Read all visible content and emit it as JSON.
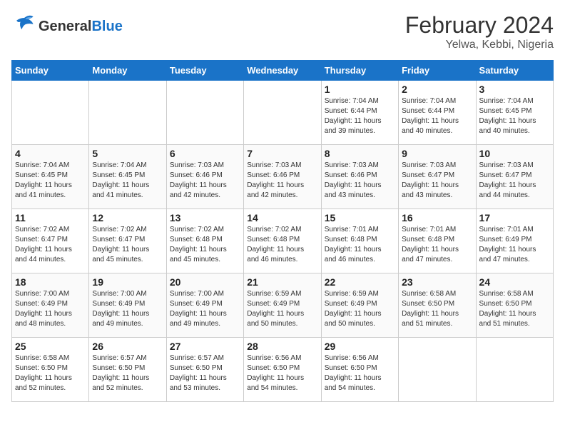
{
  "header": {
    "logo_general": "General",
    "logo_blue": "Blue",
    "title": "February 2024",
    "subtitle": "Yelwa, Kebbi, Nigeria"
  },
  "days_of_week": [
    "Sunday",
    "Monday",
    "Tuesday",
    "Wednesday",
    "Thursday",
    "Friday",
    "Saturday"
  ],
  "weeks": [
    [
      {
        "day": "",
        "info": ""
      },
      {
        "day": "",
        "info": ""
      },
      {
        "day": "",
        "info": ""
      },
      {
        "day": "",
        "info": ""
      },
      {
        "day": "1",
        "info": "Sunrise: 7:04 AM\nSunset: 6:44 PM\nDaylight: 11 hours\nand 39 minutes."
      },
      {
        "day": "2",
        "info": "Sunrise: 7:04 AM\nSunset: 6:44 PM\nDaylight: 11 hours\nand 40 minutes."
      },
      {
        "day": "3",
        "info": "Sunrise: 7:04 AM\nSunset: 6:45 PM\nDaylight: 11 hours\nand 40 minutes."
      }
    ],
    [
      {
        "day": "4",
        "info": "Sunrise: 7:04 AM\nSunset: 6:45 PM\nDaylight: 11 hours\nand 41 minutes."
      },
      {
        "day": "5",
        "info": "Sunrise: 7:04 AM\nSunset: 6:45 PM\nDaylight: 11 hours\nand 41 minutes."
      },
      {
        "day": "6",
        "info": "Sunrise: 7:03 AM\nSunset: 6:46 PM\nDaylight: 11 hours\nand 42 minutes."
      },
      {
        "day": "7",
        "info": "Sunrise: 7:03 AM\nSunset: 6:46 PM\nDaylight: 11 hours\nand 42 minutes."
      },
      {
        "day": "8",
        "info": "Sunrise: 7:03 AM\nSunset: 6:46 PM\nDaylight: 11 hours\nand 43 minutes."
      },
      {
        "day": "9",
        "info": "Sunrise: 7:03 AM\nSunset: 6:47 PM\nDaylight: 11 hours\nand 43 minutes."
      },
      {
        "day": "10",
        "info": "Sunrise: 7:03 AM\nSunset: 6:47 PM\nDaylight: 11 hours\nand 44 minutes."
      }
    ],
    [
      {
        "day": "11",
        "info": "Sunrise: 7:02 AM\nSunset: 6:47 PM\nDaylight: 11 hours\nand 44 minutes."
      },
      {
        "day": "12",
        "info": "Sunrise: 7:02 AM\nSunset: 6:47 PM\nDaylight: 11 hours\nand 45 minutes."
      },
      {
        "day": "13",
        "info": "Sunrise: 7:02 AM\nSunset: 6:48 PM\nDaylight: 11 hours\nand 45 minutes."
      },
      {
        "day": "14",
        "info": "Sunrise: 7:02 AM\nSunset: 6:48 PM\nDaylight: 11 hours\nand 46 minutes."
      },
      {
        "day": "15",
        "info": "Sunrise: 7:01 AM\nSunset: 6:48 PM\nDaylight: 11 hours\nand 46 minutes."
      },
      {
        "day": "16",
        "info": "Sunrise: 7:01 AM\nSunset: 6:48 PM\nDaylight: 11 hours\nand 47 minutes."
      },
      {
        "day": "17",
        "info": "Sunrise: 7:01 AM\nSunset: 6:49 PM\nDaylight: 11 hours\nand 47 minutes."
      }
    ],
    [
      {
        "day": "18",
        "info": "Sunrise: 7:00 AM\nSunset: 6:49 PM\nDaylight: 11 hours\nand 48 minutes."
      },
      {
        "day": "19",
        "info": "Sunrise: 7:00 AM\nSunset: 6:49 PM\nDaylight: 11 hours\nand 49 minutes."
      },
      {
        "day": "20",
        "info": "Sunrise: 7:00 AM\nSunset: 6:49 PM\nDaylight: 11 hours\nand 49 minutes."
      },
      {
        "day": "21",
        "info": "Sunrise: 6:59 AM\nSunset: 6:49 PM\nDaylight: 11 hours\nand 50 minutes."
      },
      {
        "day": "22",
        "info": "Sunrise: 6:59 AM\nSunset: 6:49 PM\nDaylight: 11 hours\nand 50 minutes."
      },
      {
        "day": "23",
        "info": "Sunrise: 6:58 AM\nSunset: 6:50 PM\nDaylight: 11 hours\nand 51 minutes."
      },
      {
        "day": "24",
        "info": "Sunrise: 6:58 AM\nSunset: 6:50 PM\nDaylight: 11 hours\nand 51 minutes."
      }
    ],
    [
      {
        "day": "25",
        "info": "Sunrise: 6:58 AM\nSunset: 6:50 PM\nDaylight: 11 hours\nand 52 minutes."
      },
      {
        "day": "26",
        "info": "Sunrise: 6:57 AM\nSunset: 6:50 PM\nDaylight: 11 hours\nand 52 minutes."
      },
      {
        "day": "27",
        "info": "Sunrise: 6:57 AM\nSunset: 6:50 PM\nDaylight: 11 hours\nand 53 minutes."
      },
      {
        "day": "28",
        "info": "Sunrise: 6:56 AM\nSunset: 6:50 PM\nDaylight: 11 hours\nand 54 minutes."
      },
      {
        "day": "29",
        "info": "Sunrise: 6:56 AM\nSunset: 6:50 PM\nDaylight: 11 hours\nand 54 minutes."
      },
      {
        "day": "",
        "info": ""
      },
      {
        "day": "",
        "info": ""
      }
    ]
  ]
}
